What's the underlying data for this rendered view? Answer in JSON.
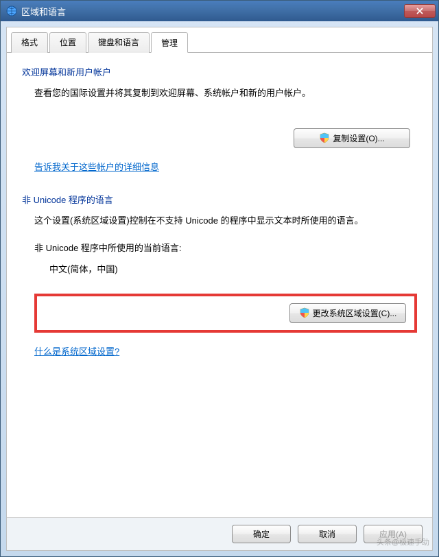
{
  "window": {
    "title": "区域和语言"
  },
  "tabs": {
    "format": "格式",
    "location": "位置",
    "keyboard": "键盘和语言",
    "admin": "管理"
  },
  "section1": {
    "title": "欢迎屏幕和新用户帐户",
    "desc": "查看您的国际设置并将其复制到欢迎屏幕、系统帐户和新的用户帐户。",
    "button": "复制设置(O)...",
    "link": "告诉我关于这些帐户的详细信息"
  },
  "section2": {
    "title": "非 Unicode 程序的语言",
    "desc": "这个设置(系统区域设置)控制在不支持 Unicode 的程序中显示文本时所使用的语言。",
    "current_label": "非 Unicode 程序中所使用的当前语言:",
    "current_value": "中文(简体，中国)",
    "button": "更改系统区域设置(C)...",
    "link": "什么是系统区域设置?"
  },
  "dialog_buttons": {
    "ok": "确定",
    "cancel": "取消",
    "apply": "应用(A)"
  },
  "watermark": "头条@极速手助"
}
